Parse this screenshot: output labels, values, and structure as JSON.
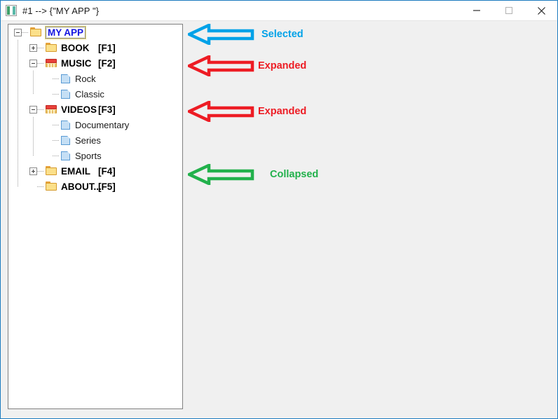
{
  "window": {
    "title": "#1 --> {\"MY APP \"}",
    "app_icon": "app-window-icon",
    "controls": {
      "minimize": "minimize-button",
      "maximize": "maximize-button",
      "close": "close-button"
    }
  },
  "tree": {
    "nodes": [
      {
        "label": "MY APP",
        "shortcut": "",
        "state": "expanded",
        "icon": "folder-open-yellow-icon",
        "depth": 0,
        "selected": true,
        "kind": "root"
      },
      {
        "label": "BOOK",
        "shortcut": "[F1]",
        "state": "collapsed",
        "icon": "folder-closed-yellow-icon",
        "depth": 1,
        "selected": false,
        "kind": "folder"
      },
      {
        "label": "MUSIC",
        "shortcut": "[F2]",
        "state": "expanded",
        "icon": "folder-open-red-icon",
        "depth": 1,
        "selected": false,
        "kind": "folder"
      },
      {
        "label": "Rock",
        "shortcut": "",
        "state": "leaf",
        "icon": "document-blue-icon",
        "depth": 2,
        "selected": false,
        "kind": "leaf"
      },
      {
        "label": "Classic",
        "shortcut": "",
        "state": "leaf",
        "icon": "document-blue-icon",
        "depth": 2,
        "selected": false,
        "kind": "leaf"
      },
      {
        "label": "VIDEOS",
        "shortcut": "[F3]",
        "state": "expanded",
        "icon": "folder-open-red-icon",
        "depth": 1,
        "selected": false,
        "kind": "folder"
      },
      {
        "label": "Documentary",
        "shortcut": "",
        "state": "leaf",
        "icon": "document-blue-icon",
        "depth": 2,
        "selected": false,
        "kind": "leaf"
      },
      {
        "label": "Series",
        "shortcut": "",
        "state": "leaf",
        "icon": "document-blue-icon",
        "depth": 2,
        "selected": false,
        "kind": "leaf"
      },
      {
        "label": "Sports",
        "shortcut": "",
        "state": "leaf",
        "icon": "document-blue-icon",
        "depth": 2,
        "selected": false,
        "kind": "leaf"
      },
      {
        "label": "EMAIL",
        "shortcut": "[F4]",
        "state": "collapsed",
        "icon": "folder-closed-yellow-icon",
        "depth": 1,
        "selected": false,
        "kind": "folder"
      },
      {
        "label": "ABOUT...",
        "shortcut": "[F5]",
        "state": "leaf",
        "icon": "folder-closed-yellow-icon",
        "depth": 1,
        "selected": false,
        "kind": "folder"
      }
    ]
  },
  "annotations": [
    {
      "text": "Selected",
      "color": "#00a2e8",
      "arrow": "arrow-left-outline-blue"
    },
    {
      "text": "Expanded",
      "color": "#ed1c24",
      "arrow": "arrow-left-outline-red"
    },
    {
      "text": "Expanded",
      "color": "#ed1c24",
      "arrow": "arrow-left-outline-red"
    },
    {
      "text": "Collapsed",
      "color": "#22b14c",
      "arrow": "arrow-left-outline-green"
    }
  ],
  "colors": {
    "window_border": "#1b7bbf",
    "window_background": "#f0f0f0",
    "panel_background": "#ffffff",
    "panel_border": "#808080",
    "titlebar_background": "#ffffff",
    "selected_text": "#1414e0",
    "node_text": "#000000"
  }
}
